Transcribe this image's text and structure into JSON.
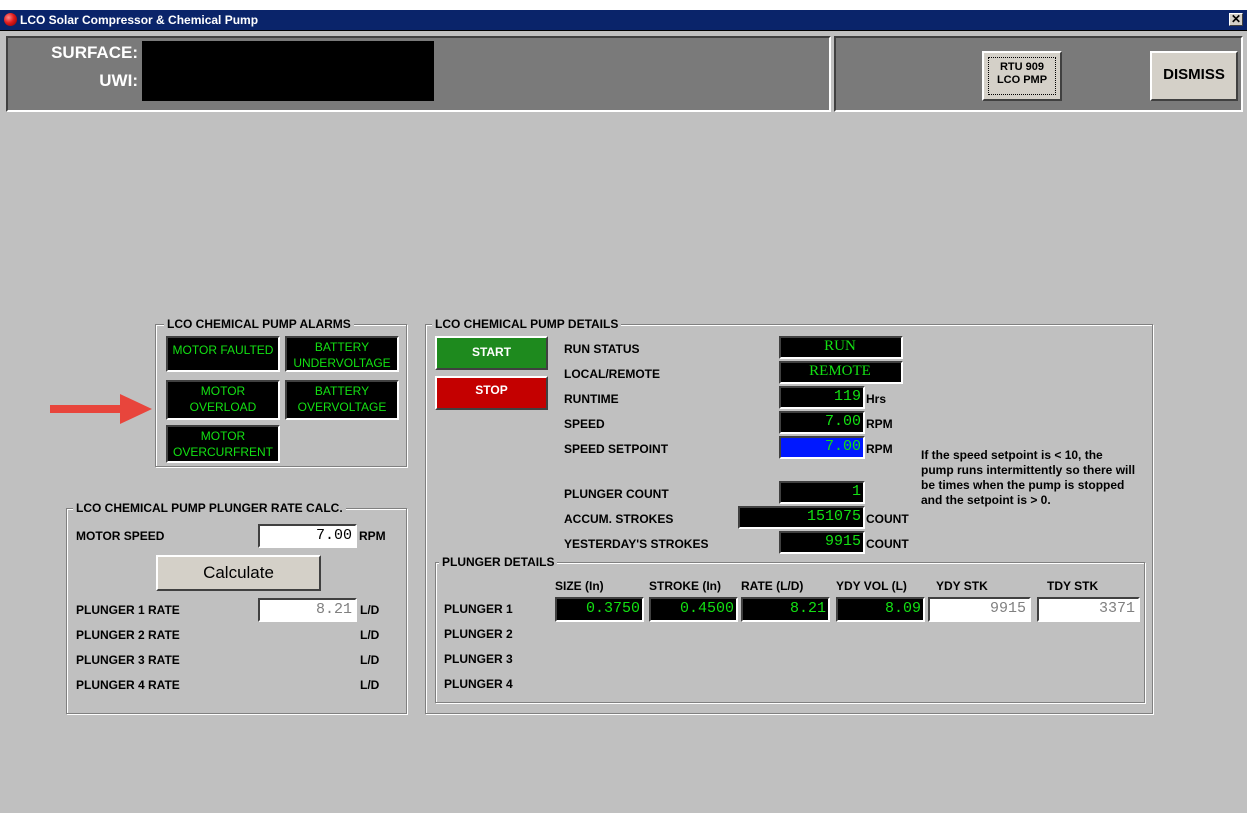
{
  "window": {
    "title": "LCO Solar Compressor & Chemical Pump",
    "close_glyph": "✕"
  },
  "header": {
    "surface_label": "SURFACE:",
    "uwi_label": "UWI:",
    "rtu_button": {
      "line1": "RTU 909",
      "line2": "LCO PMP"
    },
    "dismiss_label": "DISMISS"
  },
  "alarms": {
    "title": "LCO CHEMICAL PUMP ALARMS",
    "motor_faulted": "MOTOR FAULTED",
    "battery_under_1": "BATTERY",
    "battery_under_2": "UNDERVOLTAGE",
    "motor_overload_1": "MOTOR",
    "motor_overload_2": "OVERLOAD",
    "battery_over_1": "BATTERY",
    "battery_over_2": "OVERVOLTAGE",
    "motor_overcurrent_1": "MOTOR",
    "motor_overcurrent_2": "OVERCURFRENT"
  },
  "calc": {
    "title": "LCO CHEMICAL PUMP PLUNGER RATE CALC.",
    "motor_speed_label": "MOTOR SPEED",
    "motor_speed_value": "7.00",
    "motor_speed_unit": "RPM",
    "calculate_label": "Calculate",
    "rows": [
      {
        "label": "PLUNGER 1 RATE",
        "value": "8.21",
        "unit": "L/D"
      },
      {
        "label": "PLUNGER 2 RATE",
        "unit": "L/D"
      },
      {
        "label": "PLUNGER 3 RATE",
        "unit": "L/D"
      },
      {
        "label": "PLUNGER 4 RATE",
        "unit": "L/D"
      }
    ]
  },
  "details": {
    "title": "LCO CHEMICAL PUMP DETAILS",
    "start_label": "START",
    "stop_label": "STOP",
    "run_status_label": "RUN STATUS",
    "run_status_value": "RUN",
    "local_remote_label": "LOCAL/REMOTE",
    "local_remote_value": "REMOTE",
    "runtime_label": "RUNTIME",
    "runtime_value": "119",
    "runtime_unit": "Hrs",
    "speed_label": "SPEED",
    "speed_value": "7.00",
    "speed_unit": "RPM",
    "setpoint_label": "SPEED SETPOINT",
    "setpoint_value": "7.00",
    "setpoint_unit": "RPM",
    "note": "If the speed setpoint is < 10, the pump runs intermittently so there will be times when the pump is stopped and the setpoint is > 0.",
    "plunger_count_label": "PLUNGER COUNT",
    "plunger_count_value": "1",
    "accum_label": "ACCUM. STROKES",
    "accum_value": "151075",
    "accum_unit": "COUNT",
    "yesterday_label": "YESTERDAY'S STROKES",
    "yesterday_value": "9915",
    "yesterday_unit": "COUNT"
  },
  "plunger_details": {
    "title": "PLUNGER DETAILS",
    "headers": [
      "SIZE (In)",
      "STROKE (In)",
      "RATE (L/D)",
      "YDY VOL (L)",
      "YDY STK",
      "TDY STK"
    ],
    "rows": [
      {
        "label": "PLUNGER 1",
        "size": "0.3750",
        "stroke": "0.4500",
        "rate": "8.21",
        "ydy_vol": "8.09",
        "ydy_stk": "9915",
        "tdy_stk": "3371"
      },
      {
        "label": "PLUNGER 2"
      },
      {
        "label": "PLUNGER 3"
      },
      {
        "label": "PLUNGER 4"
      }
    ]
  },
  "colors": {
    "green_text": "#13e013",
    "start_green": "#1e8a1e",
    "stop_red": "#c40000",
    "setpoint_blue": "#0018ff",
    "annotation_arrow": "#e8453c"
  }
}
